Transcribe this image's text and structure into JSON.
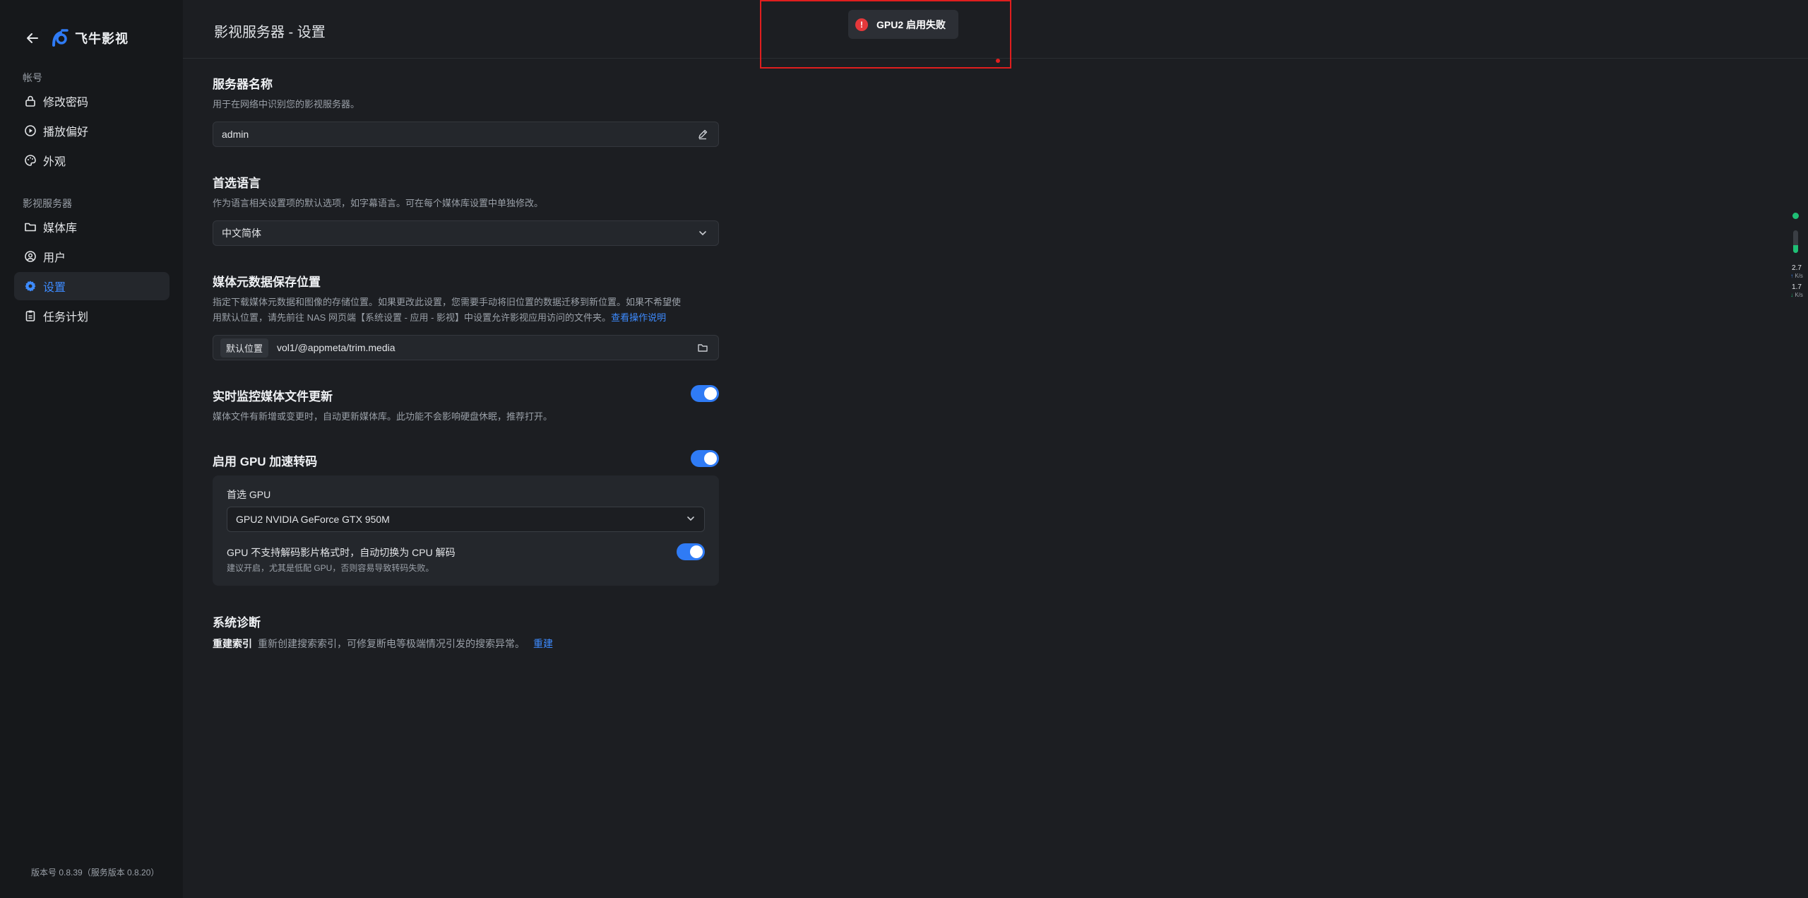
{
  "app": {
    "name": "飞牛影视"
  },
  "sidebar": {
    "groups": [
      {
        "title": "帐号",
        "items": [
          {
            "label": "修改密码",
            "icon": "lock-icon"
          },
          {
            "label": "播放偏好",
            "icon": "play-circle-icon"
          },
          {
            "label": "外观",
            "icon": "palette-icon"
          }
        ]
      },
      {
        "title": "影视服务器",
        "items": [
          {
            "label": "媒体库",
            "icon": "folder-icon"
          },
          {
            "label": "用户",
            "icon": "user-circle-icon"
          },
          {
            "label": "设置",
            "icon": "gear-icon",
            "active": true
          },
          {
            "label": "任务计划",
            "icon": "clipboard-icon"
          }
        ]
      }
    ],
    "version": "版本号 0.8.39（服务版本 0.8.20）"
  },
  "header": {
    "title": "影视服务器 - 设置"
  },
  "toast": {
    "message": "GPU2 启用失败",
    "type": "error"
  },
  "settings": {
    "server_name": {
      "title": "服务器名称",
      "desc": "用于在网络中识别您的影视服务器。",
      "value": "admin"
    },
    "language": {
      "title": "首选语言",
      "desc": "作为语言相关设置项的默认选项，如字幕语言。可在每个媒体库设置中单独修改。",
      "value": "中文简体"
    },
    "metadata_path": {
      "title": "媒体元数据保存位置",
      "desc_line1": "指定下载媒体元数据和图像的存储位置。如果更改此设置，您需要手动将旧位置的数据迁移到新位置。如果不希望使",
      "desc_line2": "用默认位置，请先前往 NAS 网页端【系统设置 - 应用 - 影视】中设置允许影视应用访问的文件夹。",
      "help_link": "查看操作说明",
      "tag": "默认位置",
      "value": "vol1/@appmeta/trim.media"
    },
    "realtime_monitor": {
      "title": "实时监控媒体文件更新",
      "desc": "媒体文件有新增或变更时，自动更新媒体库。此功能不会影响硬盘休眠，推荐打开。",
      "enabled": true
    },
    "gpu": {
      "title": "启用 GPU 加速转码",
      "enabled": true,
      "preferred_label": "首选 GPU",
      "preferred_value": "GPU2 NVIDIA GeForce GTX 950M",
      "fallback_label": "GPU 不支持解码影片格式时，自动切换为 CPU 解码",
      "fallback_desc": "建议开启，尤其是低配 GPU，否则容易导致转码失败。",
      "fallback_enabled": true
    },
    "diagnostics": {
      "title": "系统诊断",
      "rebuild_key": "重建索引",
      "rebuild_desc": "重新创建搜索索引，可修复断电等极端情况引发的搜索异常。",
      "rebuild_link": "重建"
    }
  },
  "net_widget": {
    "status": "online",
    "level": 0.35,
    "upload_rate": "2.7",
    "upload_unit": "K/s",
    "download_rate": "1.7",
    "download_unit": "K/s"
  }
}
